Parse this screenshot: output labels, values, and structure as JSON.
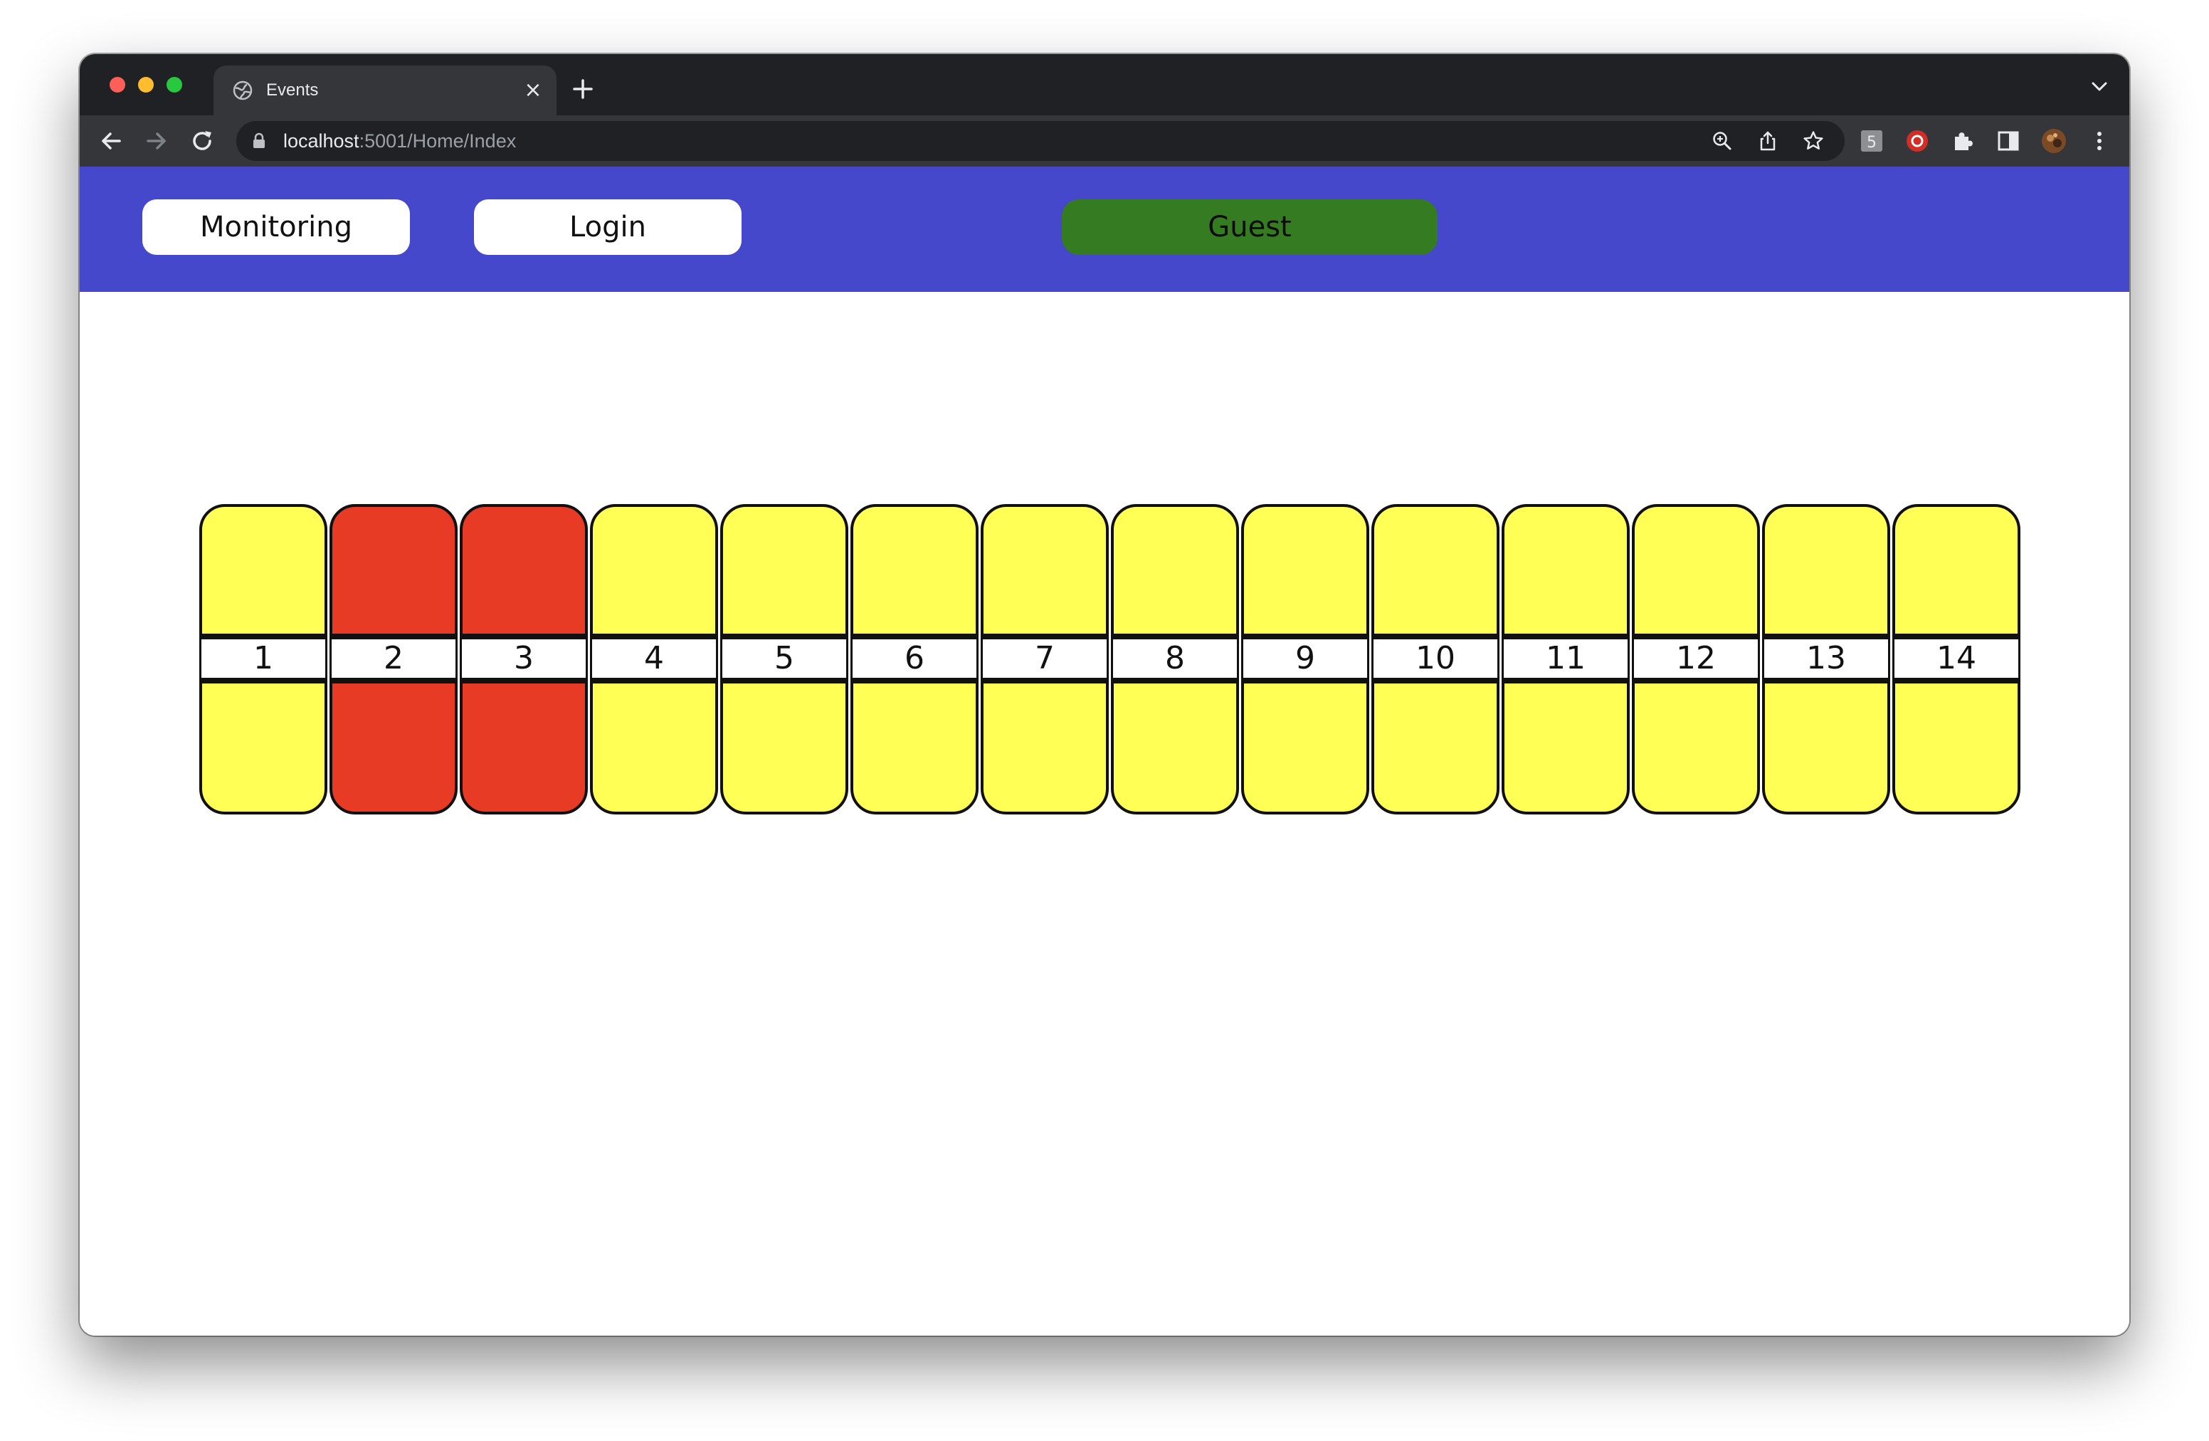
{
  "browser": {
    "tab_title": "Events",
    "url_host": "localhost",
    "url_rest": ":5001/Home/Index"
  },
  "nav": {
    "monitoring_label": "Monitoring",
    "login_label": "Login",
    "user_label": "Guest"
  },
  "colors": {
    "navbar": "#4548cb",
    "user_badge": "#357b21",
    "slot_free": "#ffff55",
    "slot_busy": "#e83b26"
  },
  "slots": [
    {
      "number": "1",
      "status": "free"
    },
    {
      "number": "2",
      "status": "busy"
    },
    {
      "number": "3",
      "status": "busy"
    },
    {
      "number": "4",
      "status": "free"
    },
    {
      "number": "5",
      "status": "free"
    },
    {
      "number": "6",
      "status": "free"
    },
    {
      "number": "7",
      "status": "free"
    },
    {
      "number": "8",
      "status": "free"
    },
    {
      "number": "9",
      "status": "free"
    },
    {
      "number": "10",
      "status": "free"
    },
    {
      "number": "11",
      "status": "free"
    },
    {
      "number": "12",
      "status": "free"
    },
    {
      "number": "13",
      "status": "free"
    },
    {
      "number": "14",
      "status": "free"
    }
  ]
}
